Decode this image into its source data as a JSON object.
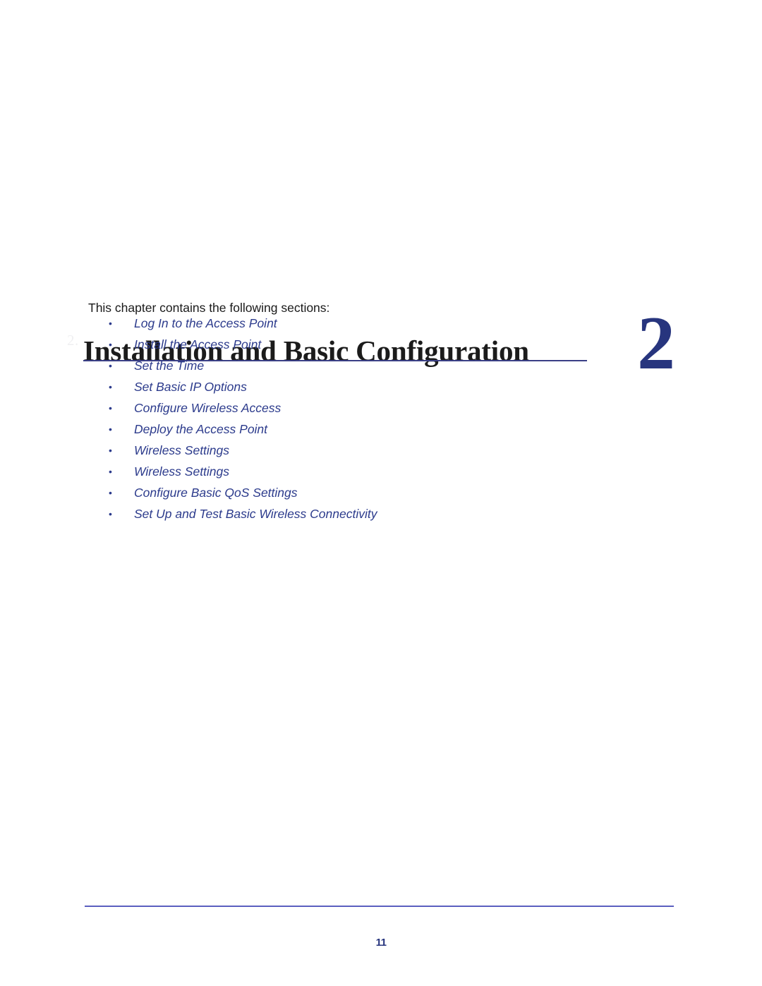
{
  "document": {
    "chapter_number": "2",
    "chapter_title": "Installation and Basic Configuration",
    "left_margin_mark": "2.",
    "intro_text": "This chapter contains the following sections:",
    "page_number": "11",
    "bullet_glyph": "•"
  },
  "colors": {
    "accent_navy": "#27357e",
    "link_blue": "#2c3b8c",
    "rule_blue": "#3a3f86",
    "footer_rule_blue": "#5b5fc0",
    "body_text": "#1a1a1a",
    "page_background": "#ffffff"
  },
  "sections": [
    {
      "label": "Log In to the Access Point"
    },
    {
      "label": "Install the Access Point"
    },
    {
      "label": "Set the Time"
    },
    {
      "label": "Set Basic IP Options"
    },
    {
      "label": "Configure Wireless Access"
    },
    {
      "label": "Deploy the Access Point"
    },
    {
      "label": "Wireless Settings"
    },
    {
      "label": "Wireless Settings"
    },
    {
      "label": "Configure Basic QoS Settings"
    },
    {
      "label": "Set Up and Test Basic Wireless Connectivity"
    }
  ]
}
